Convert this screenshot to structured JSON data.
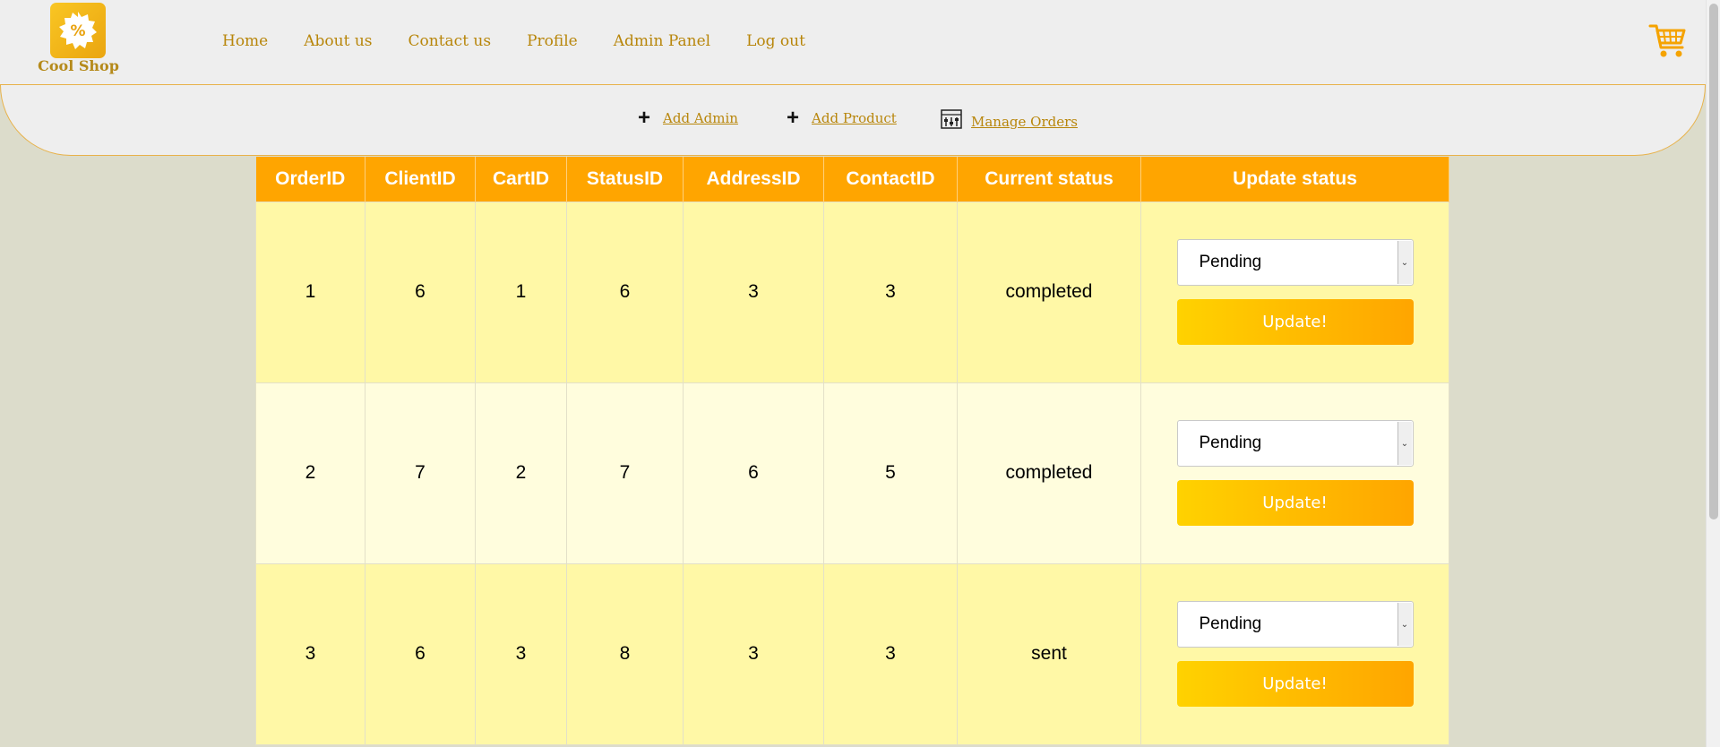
{
  "brand": {
    "name": "Cool Shop"
  },
  "nav": [
    "Home",
    "About us",
    "Contact us",
    "Profile",
    "Admin Panel",
    "Log out"
  ],
  "admin_menu": {
    "add_admin": "Add Admin",
    "add_product": "Add Product",
    "manage_orders": "Manage Orders"
  },
  "table": {
    "headers": [
      "OrderID",
      "ClientID",
      "CartID",
      "StatusID",
      "AddressID",
      "ContactID",
      "Current status",
      "Update status"
    ],
    "rows": [
      {
        "order_id": "1",
        "client_id": "6",
        "cart_id": "1",
        "status_id": "6",
        "address_id": "3",
        "contact_id": "3",
        "current_status": "completed",
        "select_value": "Pending",
        "button": "Update!"
      },
      {
        "order_id": "2",
        "client_id": "7",
        "cart_id": "2",
        "status_id": "7",
        "address_id": "6",
        "contact_id": "5",
        "current_status": "completed",
        "select_value": "Pending",
        "button": "Update!"
      },
      {
        "order_id": "3",
        "client_id": "6",
        "cart_id": "3",
        "status_id": "8",
        "address_id": "3",
        "contact_id": "3",
        "current_status": "sent",
        "select_value": "Pending",
        "button": "Update!"
      }
    ]
  },
  "colors": {
    "accent": "#ffa500",
    "link": "#b8860b",
    "row_odd": "#fff8a6",
    "row_even": "#fffddd",
    "background": "#dcdccb"
  }
}
